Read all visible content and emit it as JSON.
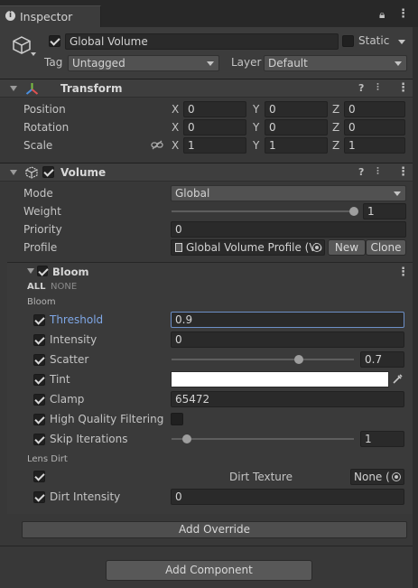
{
  "tab": {
    "title": "Inspector"
  },
  "object": {
    "name": "Global Volume",
    "static_label": "Static",
    "tag_label": "Tag",
    "tag_value": "Untagged",
    "layer_label": "Layer",
    "layer_value": "Default"
  },
  "transform": {
    "title": "Transform",
    "position_label": "Position",
    "rotation_label": "Rotation",
    "scale_label": "Scale",
    "position": {
      "x": "0",
      "y": "0",
      "z": "0"
    },
    "rotation": {
      "x": "0",
      "y": "0",
      "z": "0"
    },
    "scale": {
      "x": "1",
      "y": "1",
      "z": "1"
    },
    "axes": {
      "x": "X",
      "y": "Y",
      "z": "Z"
    }
  },
  "volume": {
    "title": "Volume",
    "mode_label": "Mode",
    "mode_value": "Global",
    "weight_label": "Weight",
    "weight_value": "1",
    "priority_label": "Priority",
    "priority_value": "0",
    "profile_label": "Profile",
    "profile_value": "Global Volume Profile (Vo",
    "new_button": "New",
    "clone_button": "Clone"
  },
  "bloom": {
    "title": "Bloom",
    "all": "ALL",
    "none": "NONE",
    "section_bloom": "Bloom",
    "threshold_label": "Threshold",
    "threshold_value": "0.9",
    "intensity_label": "Intensity",
    "intensity_value": "0",
    "scatter_label": "Scatter",
    "scatter_value": "0.7",
    "tint_label": "Tint",
    "clamp_label": "Clamp",
    "clamp_value": "65472",
    "hq_label": "High Quality Filtering",
    "skip_label": "Skip Iterations",
    "skip_value": "1",
    "section_lens": "Lens Dirt",
    "dirt_texture_label": "Dirt Texture",
    "dirt_texture_value": "None (",
    "dirt_intensity_label": "Dirt Intensity",
    "dirt_intensity_value": "0"
  },
  "buttons": {
    "add_override": "Add Override",
    "add_component": "Add Component"
  },
  "icons": [
    "info-icon",
    "lock-icon",
    "kebab-icon",
    "gameobject-cube-icon",
    "transform-axes-icon",
    "help-icon",
    "presets-icon",
    "volume-icon",
    "scale-link-icon",
    "profile-asset-icon",
    "object-picker-icon",
    "eyedropper-icon",
    "foldout-arrow-icon"
  ],
  "colors": {
    "background": "#383838",
    "field": "#2a2a2a",
    "highlight_label": "#7fa7e6",
    "focus_border": "#6c8fc7",
    "tint_swatch": "#ffffff"
  }
}
